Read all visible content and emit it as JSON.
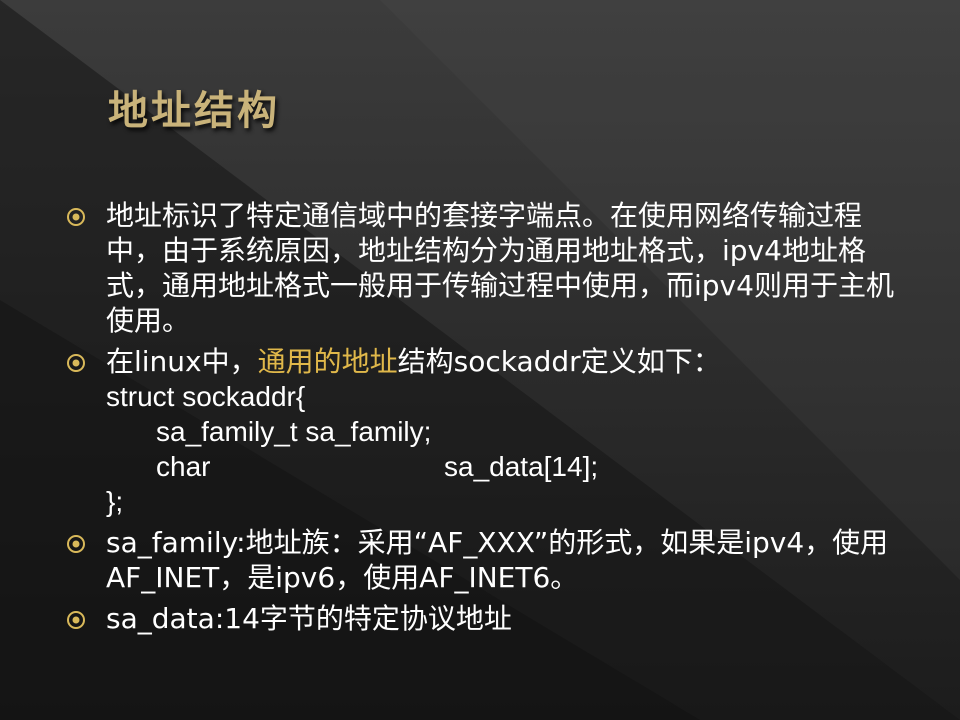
{
  "slide": {
    "title": "地址结构",
    "bullets": [
      {
        "text": "地址标识了特定通信域中的套接字端点。在使用网络传输过程中，由于系统原因，地址结构分为通用地址格式，ipv4地址格式，通用地址格式一般用于传输过程中使用，而ipv4则用于主机使用。"
      },
      {
        "prefix": "在linux中，",
        "highlight": "通用的地址",
        "suffix": "结构sockaddr定义如下：",
        "code": {
          "line1": "struct sockaddr{",
          "line2": "sa_family_t sa_family;",
          "line3_type": "char",
          "line3_field": "sa_data[14];",
          "line4": "};"
        }
      },
      {
        "text": "sa_family:地址族：采用“AF_XXX”的形式，如果是ipv4，使用AF_INET，是ipv6，使用AF_INET6。"
      },
      {
        "text": "sa_data:14字节的特定协议地址"
      }
    ]
  },
  "colors": {
    "title": "#c9b37a",
    "highlight": "#e0b84a",
    "bullet_icon": "#d9b95a",
    "text": "#ffffff"
  },
  "icons": {
    "bullet": "circle-dot-bullet-icon"
  }
}
